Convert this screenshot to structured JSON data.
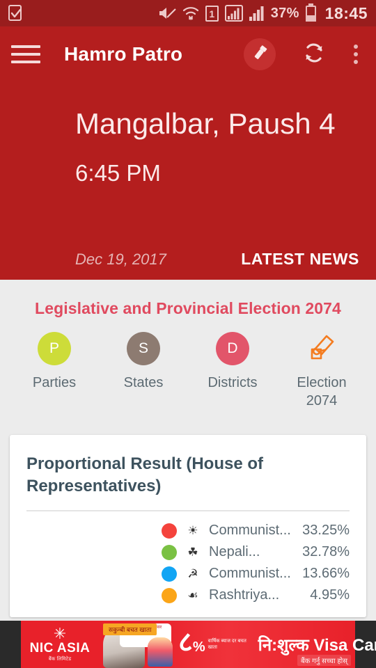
{
  "status_bar": {
    "icons": [
      "screenshot-saved-icon",
      "mute-icon",
      "wifi-icon",
      "sim1-icon",
      "signal-1-icon",
      "signal-2-icon"
    ],
    "sim_label": "1",
    "battery_percent": "37%",
    "time": "18:45"
  },
  "toolbar": {
    "menu_icon": "hamburger-menu-icon",
    "title": "Hamro Patro",
    "torch_icon": "flashlight-icon",
    "refresh_icon": "refresh-icon",
    "overflow_icon": "overflow-menu-icon"
  },
  "hero": {
    "nepali_date": "Mangalbar, Paush 4",
    "time": "6:45 PM",
    "gregorian_date": "Dec 19, 2017",
    "news_link": "LATEST NEWS"
  },
  "election_section": {
    "title": "Legislative and Provincial Election 2074",
    "quick_links": [
      {
        "label": "Parties",
        "badge": "P",
        "color": "#cddc39",
        "icon": "parties-circle-icon"
      },
      {
        "label": "States",
        "badge": "S",
        "color": "#8d7b71",
        "icon": "states-circle-icon"
      },
      {
        "label": "Districts",
        "badge": "D",
        "color": "#e2556a",
        "icon": "districts-circle-icon"
      },
      {
        "label": "Election 2074",
        "badge": "",
        "color": "#f47c20",
        "icon": "vote-hand-pen-icon"
      }
    ]
  },
  "result_card": {
    "title": "Proportional Result (House of Representatives)"
  },
  "chart_data": {
    "type": "pie",
    "title": "Proportional Result (House of Representatives)",
    "legend_position": "right",
    "categories": [
      "Communist...",
      "Nepali...",
      "Communist...",
      "Rashtriya..."
    ],
    "values": [
      33.25,
      32.78,
      13.66,
      4.95
    ],
    "value_labels": [
      "33.25%",
      "32.78%",
      "13.66%",
      "4.95%"
    ],
    "colors": [
      "#f4433c",
      "#7ac143",
      "#12a5f4",
      "#fba518"
    ],
    "symbols": [
      "sun-symbol",
      "tree-symbol",
      "hammer-sickle-symbol",
      "plough-symbol"
    ],
    "symbol_glyphs": [
      "☀",
      "☘",
      "☭",
      "☙"
    ],
    "ylabel": "",
    "xlabel": ""
  },
  "ad": {
    "brand": "NIC ASIA",
    "brand_star": "✳",
    "brand_sub": "बैंक लिमिटेड",
    "pill": "सकुन्बी बचत खाता",
    "bubble": "राम्रो सुकुन्बारी राम्रो अबसर",
    "percent": "८",
    "percent_sign": "%",
    "fine_print": "वार्षिक ब्याज दर बचत खाता",
    "headline": "नि:शुल्क Visa Card",
    "tagline": "बैंक गर्नु सच्चा होस्"
  }
}
